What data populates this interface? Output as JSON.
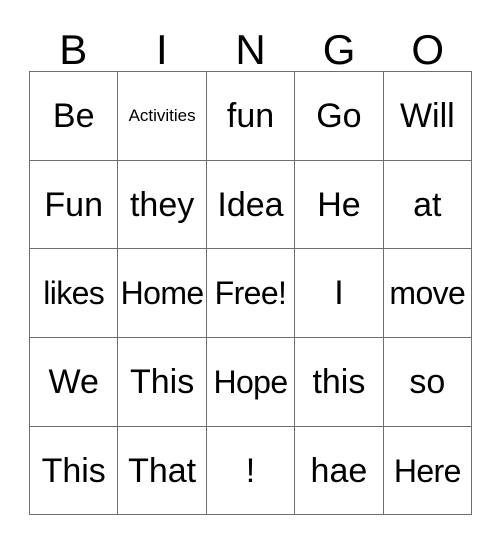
{
  "card": {
    "headers": [
      "B",
      "I",
      "N",
      "G",
      "O"
    ],
    "rows": [
      [
        {
          "text": "Be",
          "size": "normal"
        },
        {
          "text": "Activities",
          "size": "small"
        },
        {
          "text": "fun",
          "size": "normal"
        },
        {
          "text": "Go",
          "size": "normal"
        },
        {
          "text": "Will",
          "size": "normal"
        }
      ],
      [
        {
          "text": "Fun",
          "size": "normal"
        },
        {
          "text": "they",
          "size": "normal"
        },
        {
          "text": "Idea",
          "size": "normal"
        },
        {
          "text": "He",
          "size": "normal"
        },
        {
          "text": "at",
          "size": "normal"
        }
      ],
      [
        {
          "text": "likes",
          "size": "tight"
        },
        {
          "text": "Home",
          "size": "tight"
        },
        {
          "text": "Free!",
          "size": "tight"
        },
        {
          "text": "I",
          "size": "normal"
        },
        {
          "text": "move",
          "size": "tight"
        }
      ],
      [
        {
          "text": "We",
          "size": "normal"
        },
        {
          "text": "This",
          "size": "normal"
        },
        {
          "text": "Hope",
          "size": "tight"
        },
        {
          "text": "this",
          "size": "normal"
        },
        {
          "text": "so",
          "size": "normal"
        }
      ],
      [
        {
          "text": "This",
          "size": "normal"
        },
        {
          "text": "That",
          "size": "normal"
        },
        {
          "text": "!",
          "size": "normal"
        },
        {
          "text": "hae",
          "size": "normal"
        },
        {
          "text": "Here",
          "size": "tight"
        }
      ]
    ]
  },
  "colors": {
    "background": "#ffffff",
    "text": "#000000",
    "grid_line": "#6e6e6e"
  }
}
